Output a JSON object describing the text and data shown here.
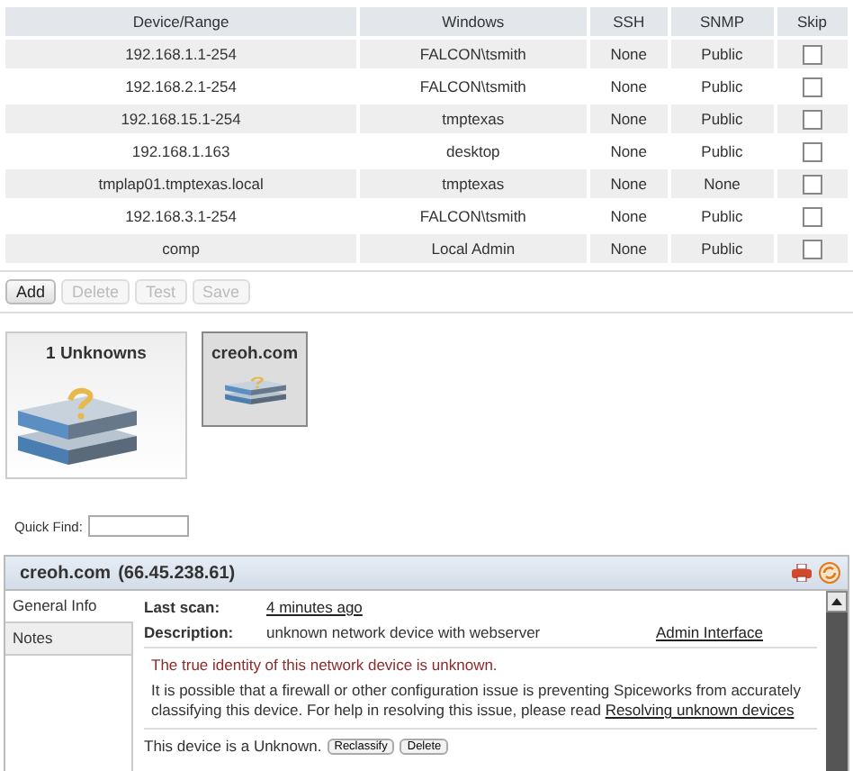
{
  "table": {
    "columns": [
      "Device/Range",
      "Windows",
      "SSH",
      "SNMP",
      "Skip"
    ],
    "rows": [
      {
        "device": "192.168.1.1-254",
        "windows": "FALCON\\tsmith",
        "ssh": "None",
        "snmp": "Public",
        "skip": false
      },
      {
        "device": "192.168.2.1-254",
        "windows": "FALCON\\tsmith",
        "ssh": "None",
        "snmp": "Public",
        "skip": false
      },
      {
        "device": "192.168.15.1-254",
        "windows": "tmptexas",
        "ssh": "None",
        "snmp": "Public",
        "skip": false
      },
      {
        "device": "192.168.1.163",
        "windows": "desktop",
        "ssh": "None",
        "snmp": "Public",
        "skip": false
      },
      {
        "device": "tmplap01.tmptexas.local",
        "windows": "tmptexas",
        "ssh": "None",
        "snmp": "None",
        "skip": false
      },
      {
        "device": "192.168.3.1-254",
        "windows": "FALCON\\tsmith",
        "ssh": "None",
        "snmp": "Public",
        "skip": false
      },
      {
        "device": "comp",
        "windows": "Local Admin",
        "ssh": "None",
        "snmp": "Public",
        "skip": false
      }
    ]
  },
  "toolbar": [
    {
      "label": "Add",
      "disabled": false
    },
    {
      "label": "Delete",
      "disabled": true
    },
    {
      "label": "Test",
      "disabled": true
    },
    {
      "label": "Save",
      "disabled": true
    }
  ],
  "groups": [
    {
      "label": "1 Unknowns",
      "selected": false,
      "kind": "large"
    },
    {
      "label": "creoh.com",
      "selected": true,
      "kind": "small"
    }
  ],
  "quick_find": {
    "label": "Quick Find:"
  },
  "detail": {
    "title": "creoh.com",
    "address": "(66.45.238.61)",
    "tabs": [
      {
        "label": "General Info",
        "selected": true
      },
      {
        "label": "Notes",
        "selected": false
      }
    ],
    "last_scan_label": "Last scan:",
    "last_scan": "4 minutes ago",
    "description_label": "Description:",
    "description": "unknown network device with webserver",
    "admin_link": "Admin Interface",
    "warning": "The true identity of this network device is unknown.",
    "explanation": "It is possible that a firewall or other configuration issue is preventing Spiceworks from accurately classifying this device. For help in resolving this issue, please read",
    "explanation_link": "Resolving unknown devices",
    "status": "This device is a Unknown.",
    "buttons": [
      "Reclassify",
      "Delete"
    ]
  }
}
